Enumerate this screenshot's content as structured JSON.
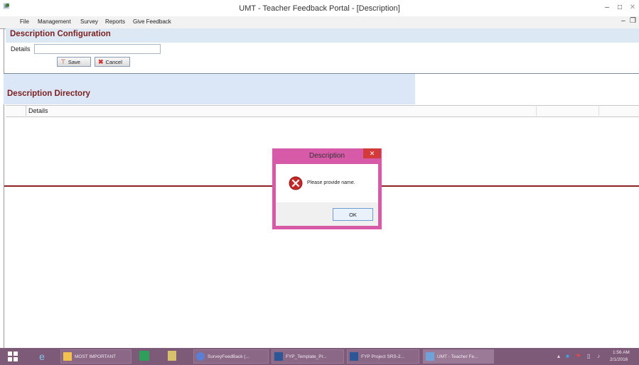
{
  "window": {
    "title": "UMT - Teacher Feedback Portal - [Description]",
    "minimize": "–",
    "maximize": "□",
    "close": "✕"
  },
  "menu": {
    "items": [
      "File",
      "Management",
      "Survey",
      "Reports",
      "Give Feedback"
    ],
    "mdi_minimize": "–",
    "mdi_restore": "❐"
  },
  "config": {
    "title": "Description Configuration",
    "details_label": "Details",
    "details_value": "",
    "save_label": "Save",
    "cancel_label": "Cancel"
  },
  "directory": {
    "title": "Description Directory",
    "columns": [
      "Details"
    ]
  },
  "dialog": {
    "title": "Description",
    "close": "✕",
    "message": "Please provide name.",
    "ok_label": "OK"
  },
  "taskbar": {
    "items": [
      {
        "label": "MOST IMPORTANT"
      },
      {
        "label": "SurveyFeedBack (..."
      },
      {
        "label": "FYP_Template_Pr..."
      },
      {
        "label": "FYP Project SRS-2..."
      },
      {
        "label": "UMT - Teacher Fe..."
      }
    ],
    "time": "1:56 AM",
    "date": "2/1/2016"
  },
  "colors": {
    "section_title": "#7b1f1f",
    "dialog_border": "#d75aa9",
    "taskbar": "#7d5a78",
    "red_line": "#8a2424"
  }
}
